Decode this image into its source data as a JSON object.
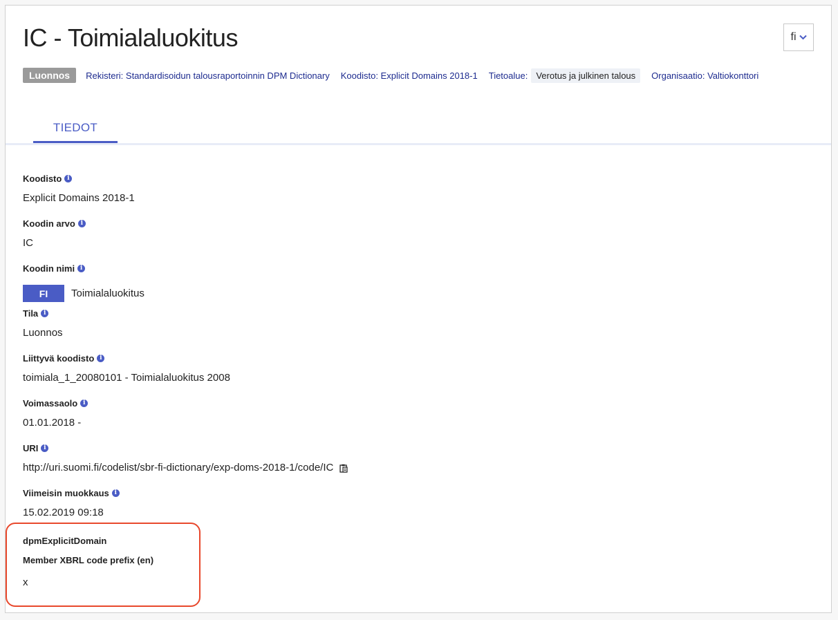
{
  "header": {
    "title": "IC - Toimialaluokitus",
    "language": "fi"
  },
  "meta": {
    "status": "Luonnos",
    "registry": "Rekisteri: Standardisoidun talousraportoinnin DPM Dictionary",
    "codelist": "Koodisto: Explicit Domains 2018-1",
    "infodomain_label": "Tietoalue:",
    "infodomain_value": "Verotus ja julkinen talous",
    "organization": "Organisaatio: Valtiokonttori"
  },
  "tabs": [
    {
      "label": "TIEDOT",
      "active": true
    }
  ],
  "fields": {
    "codelist": {
      "label": "Koodisto",
      "value": "Explicit Domains 2018-1"
    },
    "code_value": {
      "label": "Koodin arvo",
      "value": "IC"
    },
    "code_name": {
      "label": "Koodin nimi",
      "lang": "FI",
      "value": "Toimialaluokitus"
    },
    "status": {
      "label": "Tila",
      "value": "Luonnos"
    },
    "related_codelist": {
      "label": "Liittyvä koodisto",
      "value": "toimiala_1_20080101 - Toimialaluokitus 2008"
    },
    "validity": {
      "label": "Voimassaolo",
      "value": "01.01.2018 -"
    },
    "uri": {
      "label": "URI",
      "value": "http://uri.suomi.fi/codelist/sbr-fi-dictionary/exp-doms-2018-1/code/IC"
    },
    "modified": {
      "label": "Viimeisin muokkaus",
      "value": "15.02.2019 09:18"
    }
  },
  "extension": {
    "title": "dpmExplicitDomain",
    "sub_label": "Member XBRL code prefix (en)",
    "value": "x"
  },
  "colors": {
    "accent": "#4a5cc5",
    "highlight": "#e8482c",
    "badge": "#9a9a9a"
  }
}
